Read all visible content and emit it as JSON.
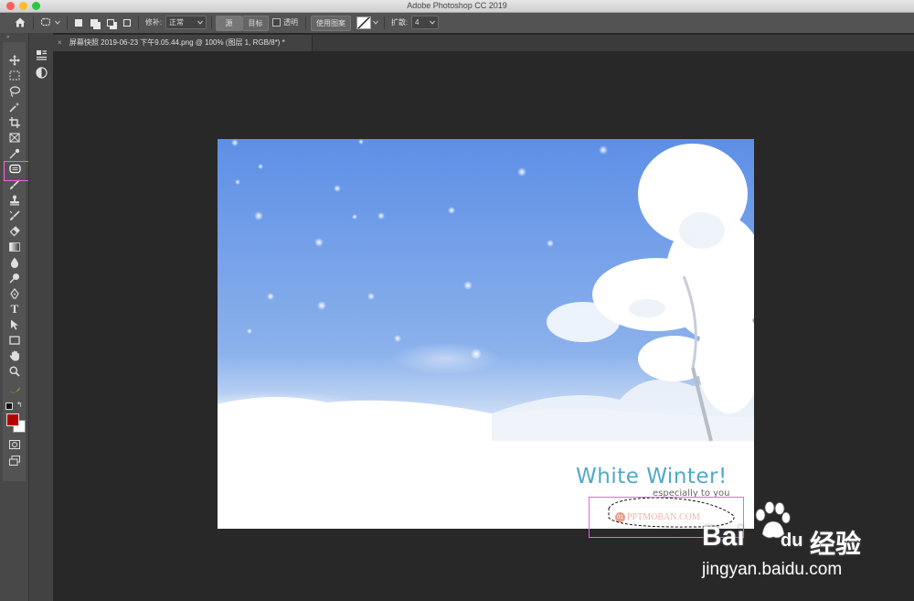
{
  "window": {
    "title": "Adobe Photoshop CC 2019"
  },
  "options_bar": {
    "home_icon": "home-icon",
    "tool_preset_icon": "patch-tool-icon",
    "patch_label": "修补:",
    "patch_mode": "正常",
    "source_label": "源",
    "target_label": "目标",
    "transparent_label": "透明",
    "use_pattern_label": "使用图案",
    "diffusion_label": "扩散:",
    "diffusion_value": "4"
  },
  "document": {
    "tab_title": "屏幕快照 2019-06-23 下午9.05.44.png @ 100% (图层 1, RGB/8*) *",
    "close_glyph": "×"
  },
  "toolbar": {
    "tools": [
      "move-tool-icon",
      "marquee-tool-icon",
      "lasso-tool-icon",
      "magic-wand-tool-icon",
      "crop-tool-icon",
      "frame-tool-icon",
      "eyedropper-tool-icon",
      "patch-tool-icon",
      "brush-tool-icon",
      "clone-stamp-tool-icon",
      "history-brush-tool-icon",
      "eraser-tool-icon",
      "gradient-tool-icon",
      "blur-tool-icon",
      "dodge-tool-icon",
      "pen-tool-icon",
      "type-tool-icon",
      "path-selection-tool-icon",
      "rectangle-tool-icon",
      "hand-tool-icon",
      "zoom-tool-icon",
      "edit-toolbar-icon"
    ],
    "type_glyph": "T",
    "foreground_color": "#b70000",
    "background_color": "#ffffff",
    "highlight_color": "#f15fe6"
  },
  "canvas": {
    "headline": "White Winter!",
    "subline": "especially to you",
    "logo_text": "PPTMOBAN.COM",
    "logo_badge": "01"
  },
  "watermark": {
    "brand_left": "Bai",
    "brand_right": "du",
    "brand_cn": "经验",
    "url": "jingyan.baidu.com"
  }
}
